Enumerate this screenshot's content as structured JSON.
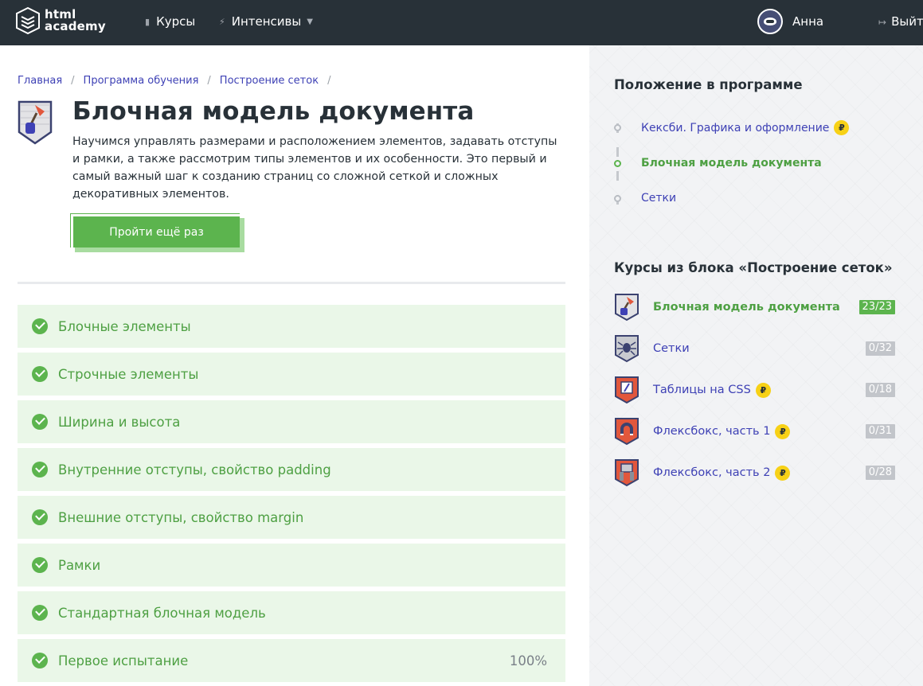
{
  "header": {
    "logo_line1": "html",
    "logo_line2": "academy",
    "nav": [
      {
        "label": "Курсы",
        "icon": "bars-icon"
      },
      {
        "label": "Интенсивы",
        "icon": "lightning-icon"
      }
    ],
    "user_name": "Анна",
    "logout_label": "Выйти"
  },
  "breadcrumbs": [
    "Главная",
    "Программа обучения",
    "Построение сеток"
  ],
  "course": {
    "title": "Блочная модель документа",
    "description": "Научимся управлять размерами и расположением элементов, задавать отступы и рамки, а также рассмотрим типы элементов и их особенности. Это первый и самый важный шаг к созданию страниц со сложной сеткой и сложных декоративных элементов.",
    "retry_button": "Пройти ещё раз"
  },
  "lessons": [
    {
      "label": "Блочные элементы",
      "done": true
    },
    {
      "label": "Строчные элементы",
      "done": true
    },
    {
      "label": "Ширина и высота",
      "done": true
    },
    {
      "label": "Внутренние отступы, свойство padding",
      "done": true
    },
    {
      "label": "Внешние отступы, свойство margin",
      "done": true
    },
    {
      "label": "Рамки",
      "done": true
    },
    {
      "label": "Стандартная блочная модель",
      "done": true
    },
    {
      "label": "Первое испытание",
      "done": true,
      "percent": "100%"
    }
  ],
  "sidebar": {
    "program_heading": "Положение в программе",
    "program": [
      {
        "label": "Кексби. Графика и оформление",
        "paid": true,
        "active": false
      },
      {
        "label": "Блочная модель документа",
        "paid": false,
        "active": true
      },
      {
        "label": "Сетки",
        "paid": false,
        "active": false
      }
    ],
    "block_heading": "Курсы из блока «Построение сеток»",
    "courses": [
      {
        "label": "Блочная модель документа",
        "progress": "23/23",
        "paid": false,
        "done": true,
        "icon": "trowel-badge-icon"
      },
      {
        "label": "Сетки",
        "progress": "0/32",
        "paid": false,
        "done": false,
        "icon": "spider-badge-icon"
      },
      {
        "label": "Таблицы на CSS",
        "progress": "0/18",
        "paid": true,
        "done": false,
        "icon": "table-badge-icon"
      },
      {
        "label": "Флексбокс, часть 1",
        "progress": "0/31",
        "paid": true,
        "done": false,
        "icon": "magnet-badge-icon"
      },
      {
        "label": "Флексбокс, часть 2",
        "progress": "0/28",
        "paid": true,
        "done": false,
        "icon": "robot-badge-icon"
      }
    ],
    "coin_symbol": "₽"
  },
  "colors": {
    "header_bg": "#283138",
    "accent_green": "#5cb44e",
    "link_blue": "#3e41b5",
    "lesson_bg": "#eaf7e8"
  }
}
